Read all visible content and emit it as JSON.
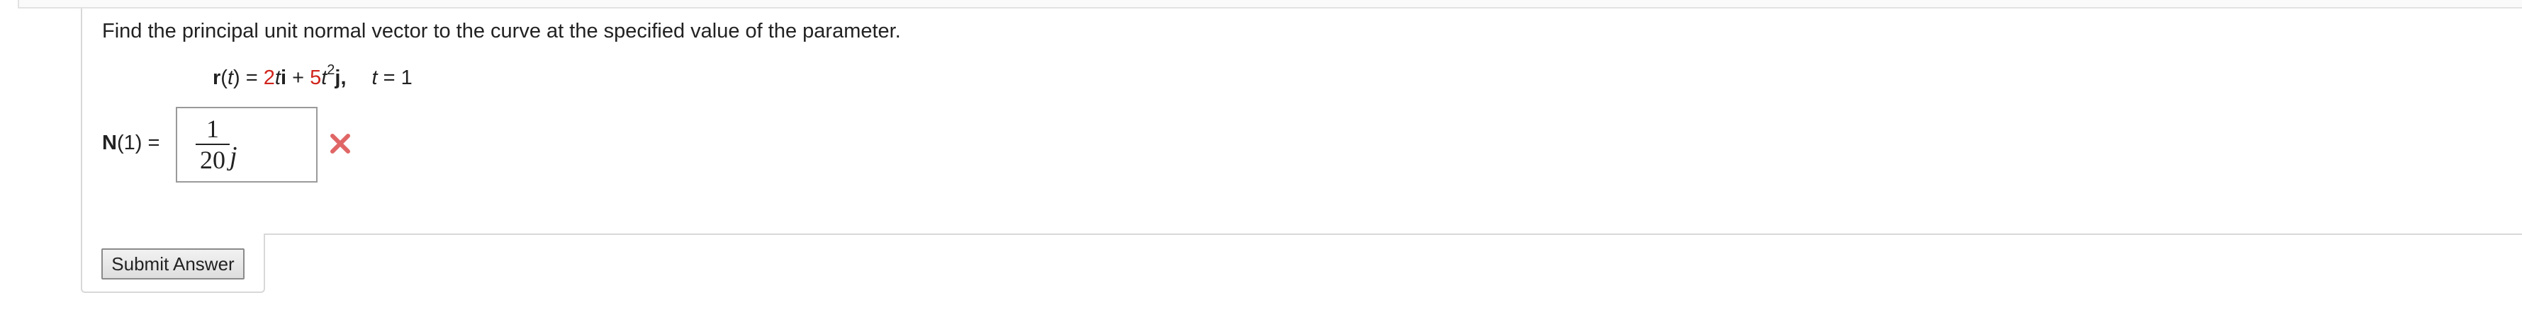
{
  "question": {
    "prompt": "Find the principal unit normal vector to the curve at the specified value of the parameter.",
    "formula": {
      "r_bold": "r",
      "paren_open": "(",
      "t_var": "t",
      "paren_close": ")",
      "equals": " = ",
      "coef1": "2",
      "t1": "t",
      "i_vec": "i",
      "plus": " + ",
      "coef2": "5",
      "t2": "t",
      "exp": "2",
      "j_vec": "j",
      "comma": ",",
      "param_var": "t",
      "param_eq": " = 1"
    },
    "colors": {
      "coefficient": "#d0241c"
    }
  },
  "answer": {
    "label_bold": "N",
    "label_rest": "(1) =",
    "numerator": "1",
    "denominator": "20",
    "variable": "j",
    "status": "incorrect",
    "status_icon": "x-mark-icon",
    "status_color": "#e06666"
  },
  "actions": {
    "submit_label": "Submit Answer"
  }
}
